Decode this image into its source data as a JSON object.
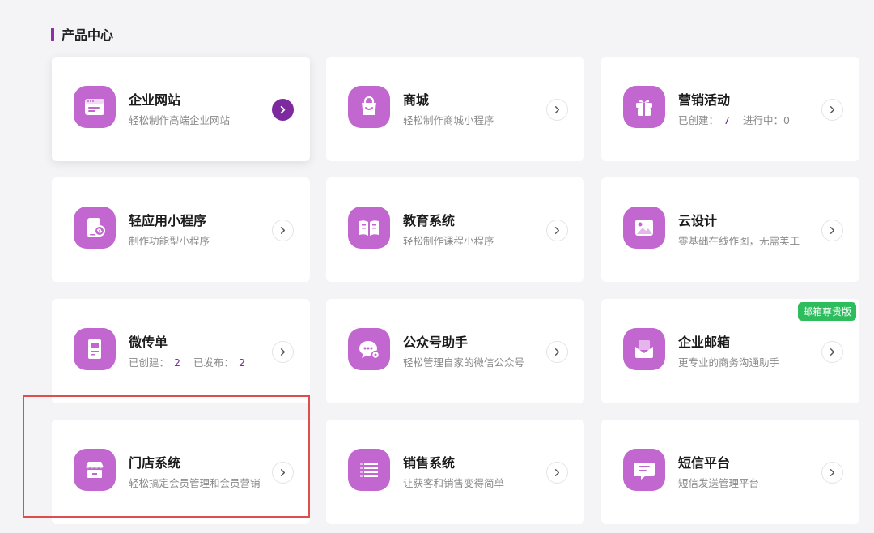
{
  "section": {
    "title": "产品中心"
  },
  "colors": {
    "accent": "#7c2a9e",
    "icon_bg": "#c266d0",
    "badge": "#2ebd5d",
    "highlight": "#e04d4d"
  },
  "cards": [
    {
      "title": "企业网站",
      "subtitle": "轻松制作高端企业网站",
      "icon": "website-icon"
    },
    {
      "title": "商城",
      "subtitle": "轻松制作商城小程序",
      "icon": "shopping-bag-icon"
    },
    {
      "title": "营销活动",
      "stat1_label": "已创建：",
      "stat1_value": "7",
      "stat2_label": "进行中：",
      "stat2_value": "0",
      "icon": "gift-icon"
    },
    {
      "title": "轻应用小程序",
      "subtitle": "制作功能型小程序",
      "icon": "mini-app-icon"
    },
    {
      "title": "教育系统",
      "subtitle": "轻松制作课程小程序",
      "icon": "book-icon"
    },
    {
      "title": "云设计",
      "subtitle": "零基础在线作图，无需美工",
      "icon": "image-icon"
    },
    {
      "title": "微传单",
      "stat1_label": "已创建：",
      "stat1_value": "2",
      "stat2_label": "已发布：",
      "stat2_value": "2",
      "icon": "flyer-icon"
    },
    {
      "title": "公众号助手",
      "subtitle": "轻松管理自家的微信公众号",
      "icon": "wechat-icon"
    },
    {
      "title": "企业邮箱",
      "subtitle": "更专业的商务沟通助手",
      "badge": "邮箱尊贵版",
      "icon": "mail-icon"
    },
    {
      "title": "门店系统",
      "subtitle": "轻松搞定会员管理和会员营销",
      "icon": "store-icon"
    },
    {
      "title": "销售系统",
      "subtitle": "让获客和销售变得简单",
      "icon": "list-icon"
    },
    {
      "title": "短信平台",
      "subtitle": "短信发送管理平台",
      "icon": "sms-icon"
    }
  ]
}
